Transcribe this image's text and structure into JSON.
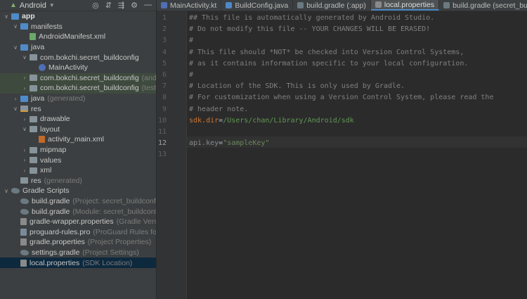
{
  "project_panel": {
    "view_mode": "Android",
    "tree": [
      {
        "label": "app",
        "bold": true,
        "indent": 0,
        "arrow": "open",
        "icon": "folder-blue"
      },
      {
        "label": "manifests",
        "indent": 1,
        "arrow": "open",
        "icon": "folder-blue"
      },
      {
        "label": "AndroidManifest.xml",
        "indent": 2,
        "arrow": "",
        "icon": "manifest"
      },
      {
        "label": "java",
        "indent": 1,
        "arrow": "open",
        "icon": "folder-blue"
      },
      {
        "label": "com.bokchi.secret_buildconfig",
        "indent": 2,
        "arrow": "open",
        "icon": "pkg"
      },
      {
        "label": "MainActivity",
        "indent": 3,
        "arrow": "",
        "icon": "kt"
      },
      {
        "label": "com.bokchi.secret_buildconfig",
        "sub": "(andro",
        "indent": 2,
        "arrow": "closed",
        "icon": "pkg",
        "hl": true
      },
      {
        "label": "com.bokchi.secret_buildconfig",
        "sub": "(test)",
        "indent": 2,
        "arrow": "closed",
        "icon": "pkg",
        "hl": true
      },
      {
        "label": "java",
        "sub": "(generated)",
        "indent": 1,
        "arrow": "closed",
        "icon": "folder-blue"
      },
      {
        "label": "res",
        "indent": 1,
        "arrow": "open",
        "icon": "res"
      },
      {
        "label": "drawable",
        "indent": 2,
        "arrow": "closed",
        "icon": "folder"
      },
      {
        "label": "layout",
        "indent": 2,
        "arrow": "open",
        "icon": "folder"
      },
      {
        "label": "activity_main.xml",
        "indent": 3,
        "arrow": "",
        "icon": "xml"
      },
      {
        "label": "mipmap",
        "indent": 2,
        "arrow": "closed",
        "icon": "folder"
      },
      {
        "label": "values",
        "indent": 2,
        "arrow": "closed",
        "icon": "folder"
      },
      {
        "label": "xml",
        "indent": 2,
        "arrow": "closed",
        "icon": "folder"
      },
      {
        "label": "res",
        "sub": "(generated)",
        "indent": 1,
        "arrow": "",
        "icon": "folder"
      },
      {
        "label": "Gradle Scripts",
        "indent": 0,
        "arrow": "open",
        "icon": "gradle"
      },
      {
        "label": "build.gradle",
        "sub": "(Project: secret_buildconfig)",
        "indent": 1,
        "arrow": "",
        "icon": "gradle"
      },
      {
        "label": "build.gradle",
        "sub": "(Module: secret_buildconfig",
        "indent": 1,
        "arrow": "",
        "icon": "gradle"
      },
      {
        "label": "gradle-wrapper.properties",
        "sub": "(Gradle Versi",
        "indent": 1,
        "arrow": "",
        "icon": "props"
      },
      {
        "label": "proguard-rules.pro",
        "sub": "(ProGuard Rules for s",
        "indent": 1,
        "arrow": "",
        "icon": "pro"
      },
      {
        "label": "gradle.properties",
        "sub": "(Project Properties)",
        "indent": 1,
        "arrow": "",
        "icon": "props"
      },
      {
        "label": "settings.gradle",
        "sub": "(Project Settings)",
        "indent": 1,
        "arrow": "",
        "icon": "gradle"
      },
      {
        "label": "local.properties",
        "sub": "(SDK Location)",
        "indent": 1,
        "arrow": "",
        "icon": "props",
        "sel": true
      }
    ]
  },
  "tabs": [
    {
      "label": "MainActivity.kt",
      "color": "#4e6fb4",
      "active": false
    },
    {
      "label": "BuildConfig.java",
      "color": "#4e88c7",
      "active": false
    },
    {
      "label": "build.gradle (:app)",
      "color": "#6b7a80",
      "active": false
    },
    {
      "label": "local.properties",
      "color": "#8a8a8a",
      "active": true
    },
    {
      "label": "build.gradle (secret_buildconfig)",
      "color": "#6b7a80",
      "active": false
    }
  ],
  "editor": {
    "current_line": 12,
    "lines": [
      {
        "n": "1",
        "parts": [
          {
            "t": "## This file is automatically generated by Android Studio.",
            "c": "comment"
          }
        ]
      },
      {
        "n": "2",
        "parts": [
          {
            "t": "# Do not modify this file -- YOUR CHANGES WILL BE ERASED!",
            "c": "comment"
          }
        ]
      },
      {
        "n": "3",
        "parts": [
          {
            "t": "#",
            "c": "comment"
          }
        ]
      },
      {
        "n": "4",
        "parts": [
          {
            "t": "# This file should *NOT* be checked into Version Control Systems,",
            "c": "comment"
          }
        ]
      },
      {
        "n": "5",
        "parts": [
          {
            "t": "# as it contains information specific to your local configuration.",
            "c": "comment"
          }
        ]
      },
      {
        "n": "6",
        "parts": [
          {
            "t": "#",
            "c": "comment"
          }
        ]
      },
      {
        "n": "7",
        "parts": [
          {
            "t": "# Location of the SDK. This is only used by Gradle.",
            "c": "comment"
          }
        ]
      },
      {
        "n": "8",
        "parts": [
          {
            "t": "# For customization when using a Version Control System, please read the",
            "c": "comment"
          }
        ]
      },
      {
        "n": "9",
        "parts": [
          {
            "t": "# header note.",
            "c": "comment"
          }
        ]
      },
      {
        "n": "10",
        "parts": [
          {
            "t": "sdk.dir",
            "c": "key"
          },
          {
            "t": "=",
            "c": "eq"
          },
          {
            "t": "/Users/chan/Library/Android/sdk",
            "c": "path"
          }
        ]
      },
      {
        "n": "11",
        "parts": []
      },
      {
        "n": "12",
        "parts": [
          {
            "t": "api.key",
            "c": "key2"
          },
          {
            "t": "=",
            "c": "eq"
          },
          {
            "t": "\"sampleKey\"",
            "c": "str"
          }
        ]
      },
      {
        "n": "13",
        "parts": []
      }
    ]
  }
}
